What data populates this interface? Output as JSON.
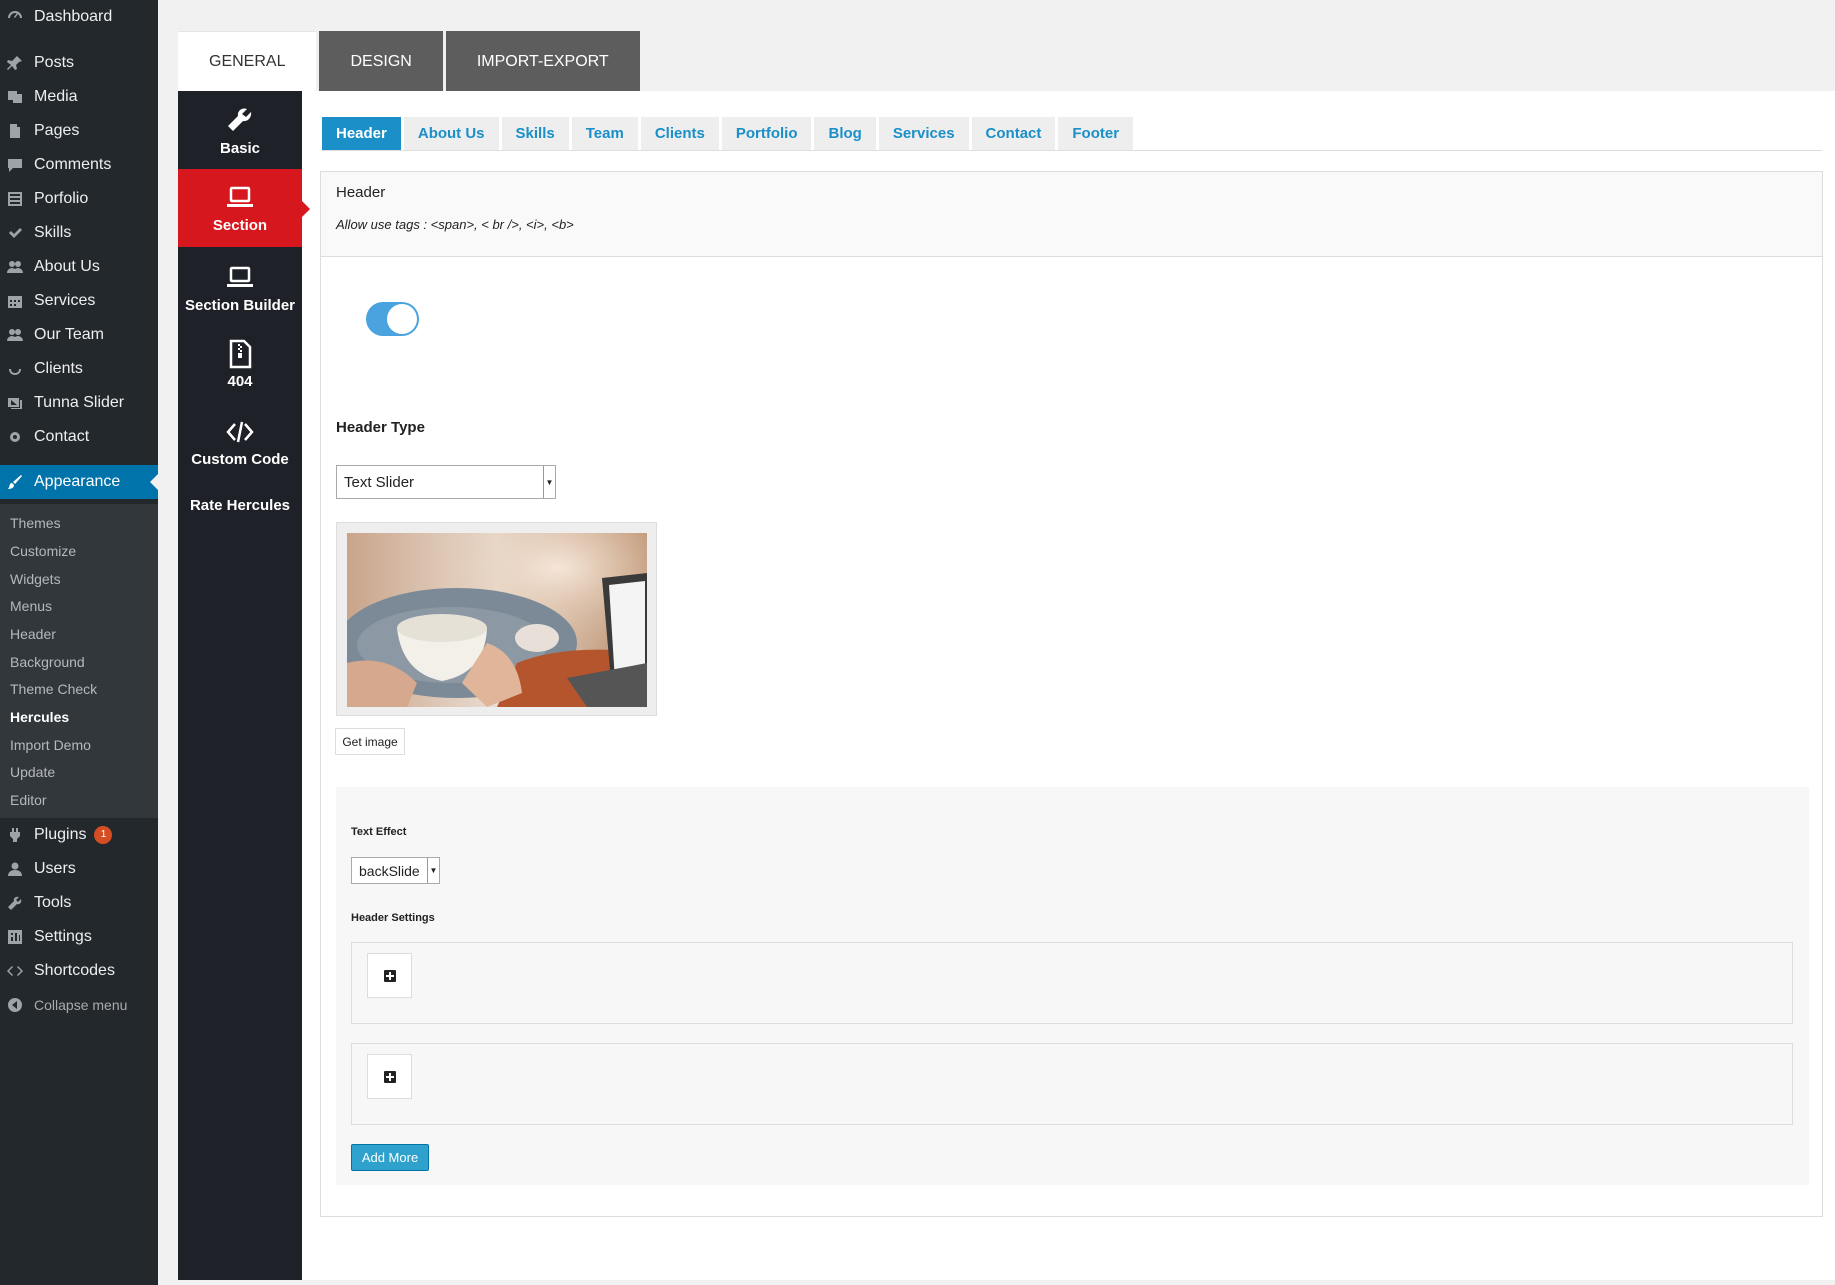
{
  "wp_menu": {
    "items": [
      {
        "label": "Dashboard",
        "icon": "dashboard-icon"
      },
      {
        "label": "Posts",
        "icon": "pin-icon"
      },
      {
        "label": "Media",
        "icon": "media-icon"
      },
      {
        "label": "Pages",
        "icon": "page-icon"
      },
      {
        "label": "Comments",
        "icon": "comment-icon"
      },
      {
        "label": "Porfolio",
        "icon": "grid-icon"
      },
      {
        "label": "Skills",
        "icon": "check-icon"
      },
      {
        "label": "About Us",
        "icon": "group-icon"
      },
      {
        "label": "Services",
        "icon": "calendar-icon"
      },
      {
        "label": "Our Team",
        "icon": "group-icon"
      },
      {
        "label": "Clients",
        "icon": "smile-icon"
      },
      {
        "label": "Tunna Slider",
        "icon": "images-icon"
      },
      {
        "label": "Contact",
        "icon": "gear-icon"
      },
      {
        "label": "Appearance",
        "icon": "brush-icon"
      }
    ],
    "submenu": [
      "Themes",
      "Customize",
      "Widgets",
      "Menus",
      "Header",
      "Background",
      "Theme Check",
      "Hercules",
      "Import Demo",
      "Update",
      "Editor"
    ],
    "bottom": [
      {
        "label": "Plugins",
        "icon": "plugin-icon",
        "badge": "1"
      },
      {
        "label": "Users",
        "icon": "user-icon"
      },
      {
        "label": "Tools",
        "icon": "wrench-icon"
      },
      {
        "label": "Settings",
        "icon": "settings-icon"
      },
      {
        "label": "Shortcodes",
        "icon": "code-icon"
      }
    ],
    "collapse": "Collapse menu"
  },
  "top_tabs": [
    "GENERAL",
    "DESIGN",
    "IMPORT-EXPORT"
  ],
  "left_nav": [
    {
      "label": "Basic",
      "icon": "wrench-icon"
    },
    {
      "label": "Section",
      "icon": "laptop-icon"
    },
    {
      "label": "Section Builder",
      "icon": "laptop-icon"
    },
    {
      "label": "404",
      "icon": "file-zip-icon"
    },
    {
      "label": "Custom Code",
      "icon": "code-icon"
    },
    {
      "label": "Rate Hercules",
      "icon": ""
    }
  ],
  "sub_tabs": [
    "Header",
    "About Us",
    "Skills",
    "Team",
    "Clients",
    "Portfolio",
    "Blog",
    "Services",
    "Contact",
    "Footer"
  ],
  "section": {
    "title": "Header",
    "hint": "Allow use tags : <span>, < br />, <i>, <b>",
    "header_type_label": "Header Type",
    "header_type_value": "Text Slider",
    "get_image": "Get image",
    "text_effect_label": "Text Effect",
    "text_effect_value": "backSlide",
    "header_settings_label": "Header Settings",
    "add_more": "Add More"
  },
  "colors": {
    "accent": "#1a8fc8",
    "active_section": "#d6181e",
    "wp_active": "#0073aa"
  }
}
